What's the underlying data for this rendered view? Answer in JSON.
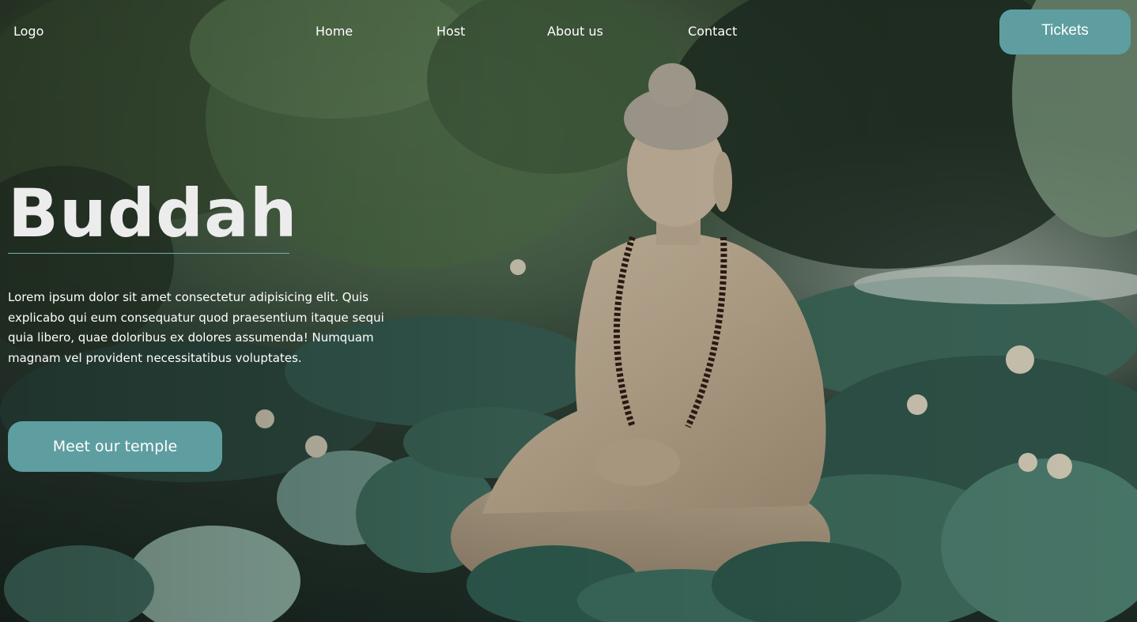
{
  "nav": {
    "logo": "Logo",
    "links": [
      "Home",
      "Host",
      "About us",
      "Contact"
    ],
    "tickets_label": "Tickets"
  },
  "hero": {
    "title": "Buddah",
    "description": "Lorem ipsum dolor sit amet consectetur adipisicing elit. Quis explicabo qui eum consequatur quod praesentium itaque sequi quia libero, quae doloribus ex dolores assumenda! Numquam magnam vel provident necessitatibus voluptates.",
    "cta_label": "Meet our temple"
  },
  "colors": {
    "accent": "#5e9ea0",
    "title_text": "#ececec",
    "rule": "#6fb0b2"
  },
  "background_image": "buddha-statue-among-lotus-leaves"
}
